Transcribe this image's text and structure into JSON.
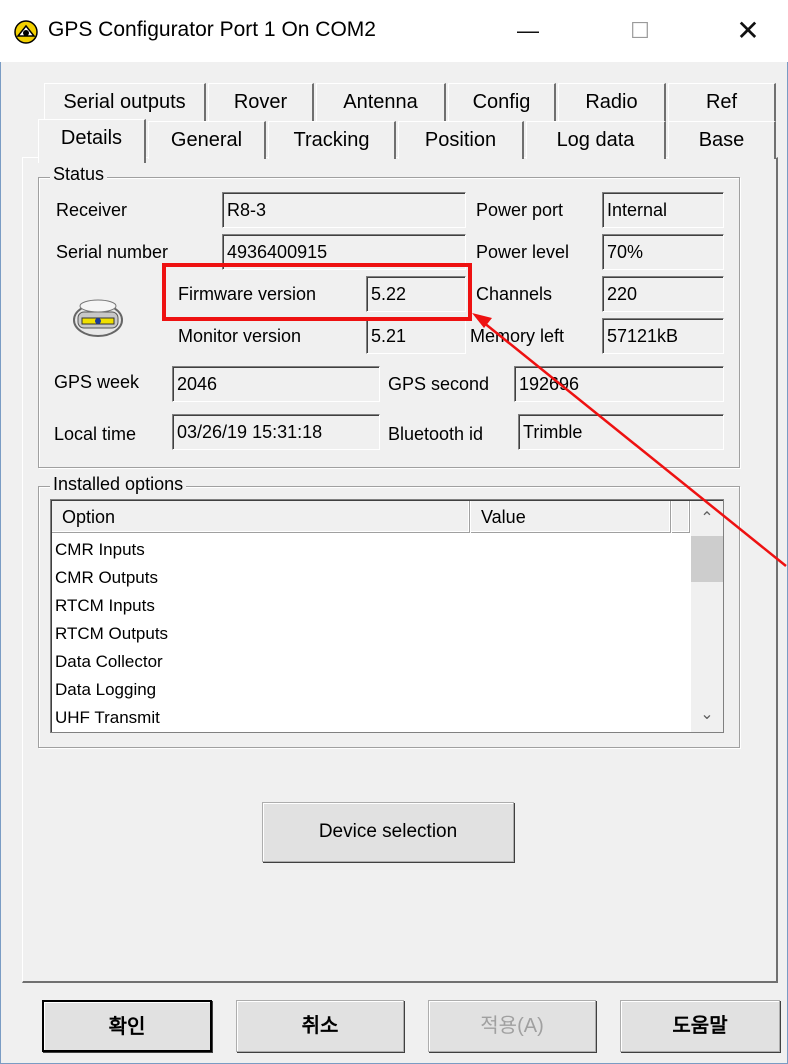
{
  "window": {
    "title": "GPS Configurator Port 1 On COM2",
    "icon": "gps-app-icon",
    "controls": {
      "minimize": "—",
      "maximize": "☐",
      "close": "✕"
    }
  },
  "tabs": {
    "row_back": [
      "Serial outputs",
      "Rover",
      "Antenna",
      "Config",
      "Radio",
      "Ref"
    ],
    "row_front": [
      "Details",
      "General",
      "Tracking",
      "Position",
      "Log data",
      "Base"
    ],
    "active": "Details"
  },
  "status": {
    "group_title": "Status",
    "receiver_label": "Receiver",
    "receiver_value": "R8-3",
    "serial_label": "Serial number",
    "serial_value": "4936400915",
    "firmware_label": "Firmware version",
    "firmware_value": "5.22",
    "monitor_label": "Monitor version",
    "monitor_value": "5.21",
    "power_port_label": "Power port",
    "power_port_value": "Internal",
    "power_level_label": "Power level",
    "power_level_value": "70%",
    "channels_label": "Channels",
    "channels_value": "220",
    "memory_label": "Memory left",
    "memory_value": "57121kB",
    "gps_week_label": "GPS week",
    "gps_week_value": "2046",
    "gps_second_label": "GPS second",
    "gps_second_value": "192696",
    "local_time_label": "Local time",
    "local_time_value": "03/26/19 15:31:18",
    "bluetooth_label": "Bluetooth id",
    "bluetooth_value": "Trimble"
  },
  "options": {
    "group_title": "Installed options",
    "columns": [
      "Option",
      "Value"
    ],
    "rows": [
      "CMR Inputs",
      "CMR Outputs",
      "RTCM Inputs",
      "RTCM Outputs",
      "Data Collector",
      "Data Logging",
      "UHF Transmit"
    ],
    "scroll_up": "⌃",
    "scroll_down": "⌄"
  },
  "device_selection_label": "Device selection",
  "dialog_buttons": {
    "ok": "확인",
    "cancel": "취소",
    "apply": "적용(A)",
    "help": "도움말"
  },
  "colors": {
    "highlight": "#e11111",
    "window_border": "#7a9cc4"
  }
}
